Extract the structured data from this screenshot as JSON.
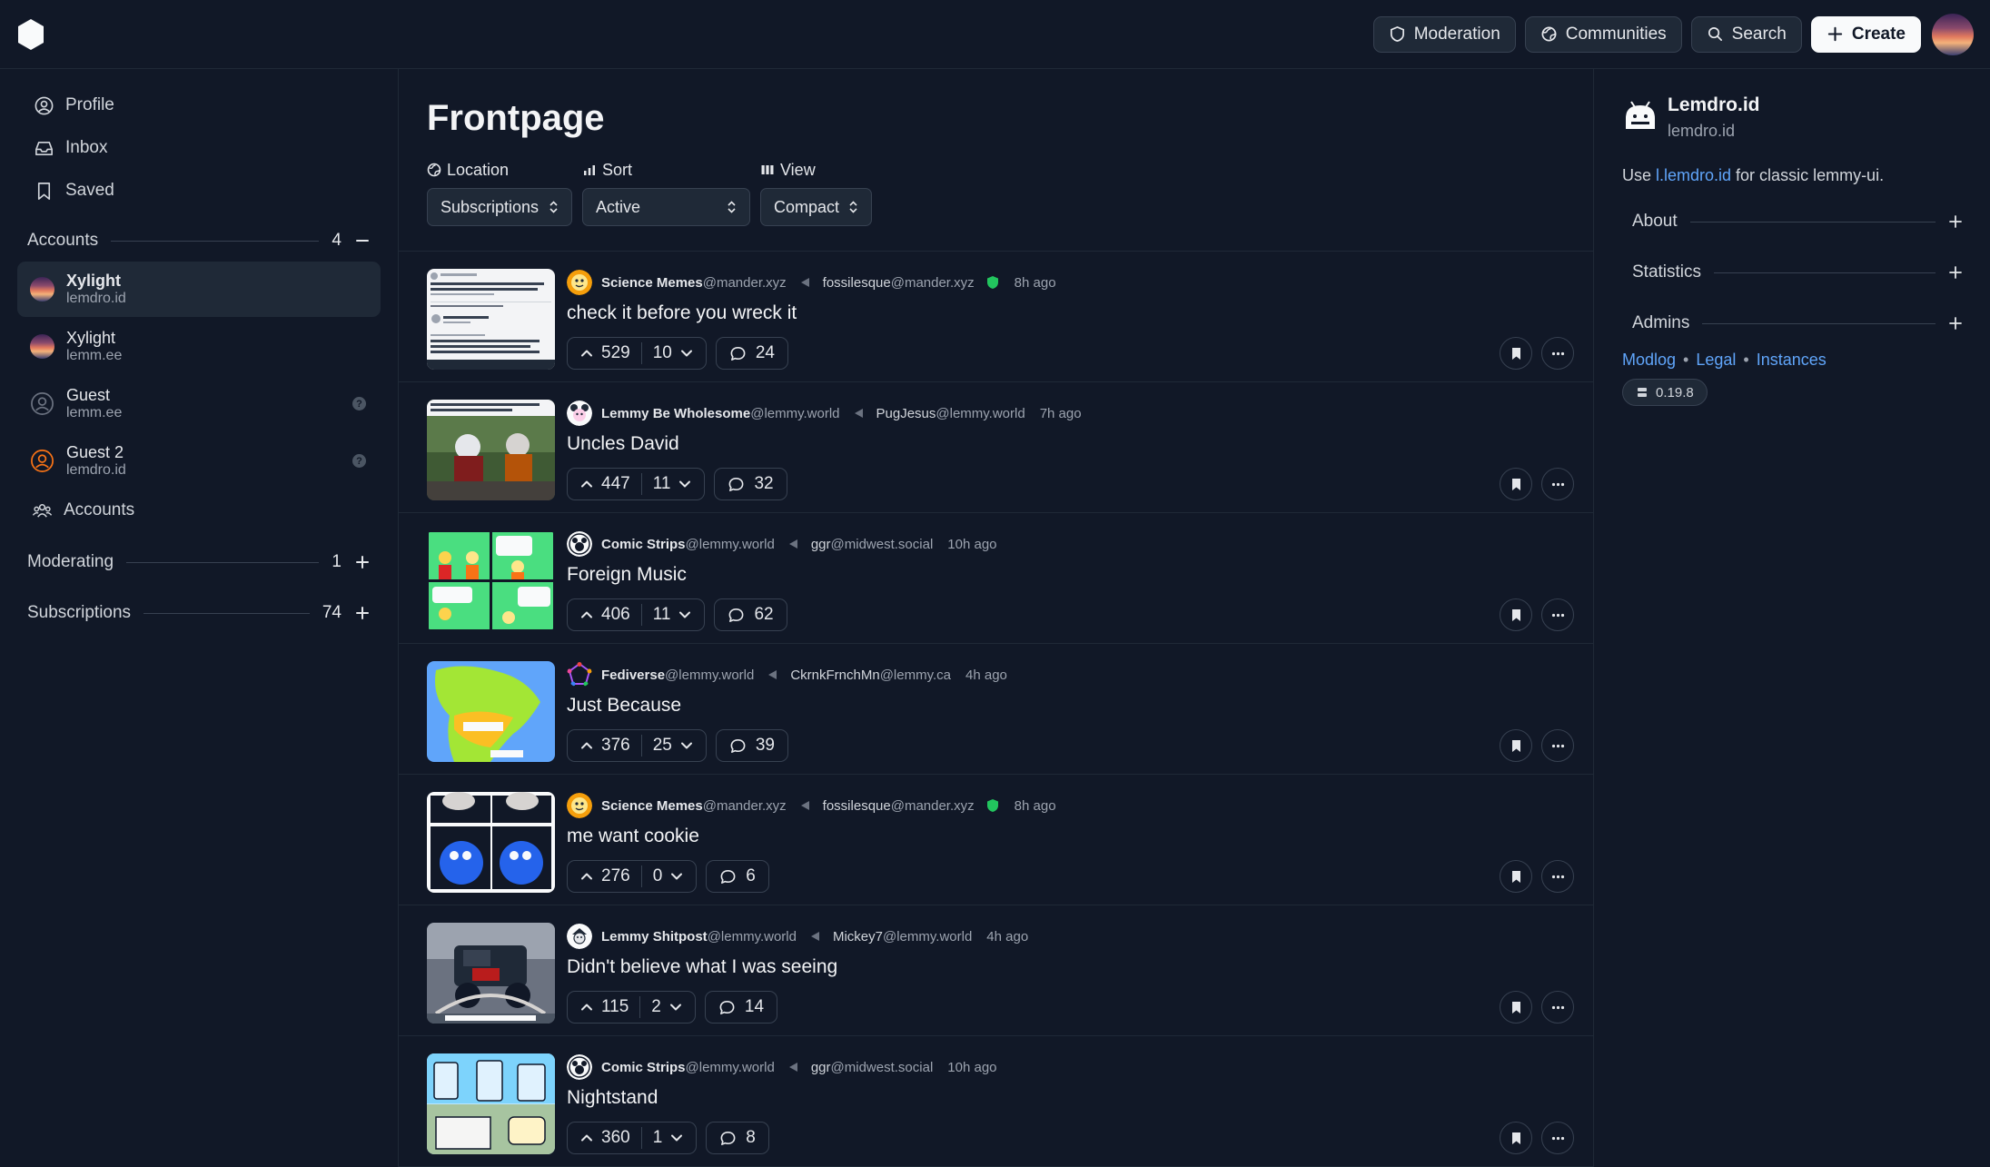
{
  "topbar": {
    "moderation": "Moderation",
    "communities": "Communities",
    "search": "Search",
    "create": "Create"
  },
  "sidebar": {
    "links": [
      {
        "label": "Profile",
        "icon": "user-circle-icon"
      },
      {
        "label": "Inbox",
        "icon": "inbox-icon"
      },
      {
        "label": "Saved",
        "icon": "bookmark-icon"
      }
    ],
    "accounts_section": {
      "label": "Accounts",
      "count": "4"
    },
    "accounts": [
      {
        "name": "Xylight",
        "instance": "lemdro.id",
        "active": true
      },
      {
        "name": "Xylight",
        "instance": "lemm.ee",
        "active": false
      },
      {
        "name": "Guest",
        "instance": "lemm.ee",
        "active": false
      },
      {
        "name": "Guest 2",
        "instance": "lemdro.id",
        "active": false
      }
    ],
    "manage_accounts": "Accounts",
    "moderating": {
      "label": "Moderating",
      "count": "1"
    },
    "subscriptions": {
      "label": "Subscriptions",
      "count": "74"
    }
  },
  "main": {
    "title": "Frontpage",
    "filters": {
      "location": {
        "label": "Location",
        "value": "Subscriptions"
      },
      "sort": {
        "label": "Sort",
        "value": "Active"
      },
      "view": {
        "label": "View",
        "value": "Compact"
      }
    },
    "posts": [
      {
        "community": "Science Memes",
        "community_instance": "@mander.xyz",
        "user": "fossilesque",
        "user_instance": "@mander.xyz",
        "mod_badge": true,
        "time": "8h ago",
        "title": "check it before you wreck it",
        "upvotes": "529",
        "downvotes": "10",
        "comments": "24"
      },
      {
        "community": "Lemmy Be Wholesome",
        "community_instance": "@lemmy.world",
        "user": "PugJesus",
        "user_instance": "@lemmy.world",
        "mod_badge": false,
        "time": "7h ago",
        "title": "Uncles David",
        "upvotes": "447",
        "downvotes": "11",
        "comments": "32"
      },
      {
        "community": "Comic Strips",
        "community_instance": "@lemmy.world",
        "user": "ggr",
        "user_instance": "@midwest.social",
        "mod_badge": false,
        "time": "10h ago",
        "title": "Foreign Music",
        "upvotes": "406",
        "downvotes": "11",
        "comments": "62"
      },
      {
        "community": "Fediverse",
        "community_instance": "@lemmy.world",
        "user": "CkrnkFrnchMn",
        "user_instance": "@lemmy.ca",
        "mod_badge": false,
        "time": "4h ago",
        "title": "Just Because",
        "upvotes": "376",
        "downvotes": "25",
        "comments": "39"
      },
      {
        "community": "Science Memes",
        "community_instance": "@mander.xyz",
        "user": "fossilesque",
        "user_instance": "@mander.xyz",
        "mod_badge": true,
        "time": "8h ago",
        "title": "me want cookie",
        "upvotes": "276",
        "downvotes": "0",
        "comments": "6"
      },
      {
        "community": "Lemmy Shitpost",
        "community_instance": "@lemmy.world",
        "user": "Mickey7",
        "user_instance": "@lemmy.world",
        "mod_badge": false,
        "time": "4h ago",
        "title": "Didn't believe what I was seeing",
        "upvotes": "115",
        "downvotes": "2",
        "comments": "14"
      },
      {
        "community": "Comic Strips",
        "community_instance": "@lemmy.world",
        "user": "ggr",
        "user_instance": "@midwest.social",
        "mod_badge": false,
        "time": "10h ago",
        "title": "Nightstand",
        "upvotes": "360",
        "downvotes": "1",
        "comments": "8"
      }
    ]
  },
  "rightbar": {
    "site_name": "Lemdro.id",
    "site_domain": "lemdro.id",
    "desc_prefix": "Use ",
    "desc_link": "l.lemdro.id",
    "desc_suffix": " for classic lemmy-ui.",
    "sections": [
      "About",
      "Statistics",
      "Admins"
    ],
    "footer": {
      "modlog": "Modlog",
      "legal": "Legal",
      "instances": "Instances"
    },
    "version": "0.19.8"
  },
  "colors": {
    "background": "#111827",
    "surface": "#1f2937",
    "border": "#374151",
    "link": "#60a5fa",
    "mod_badge": "#22c55e"
  }
}
